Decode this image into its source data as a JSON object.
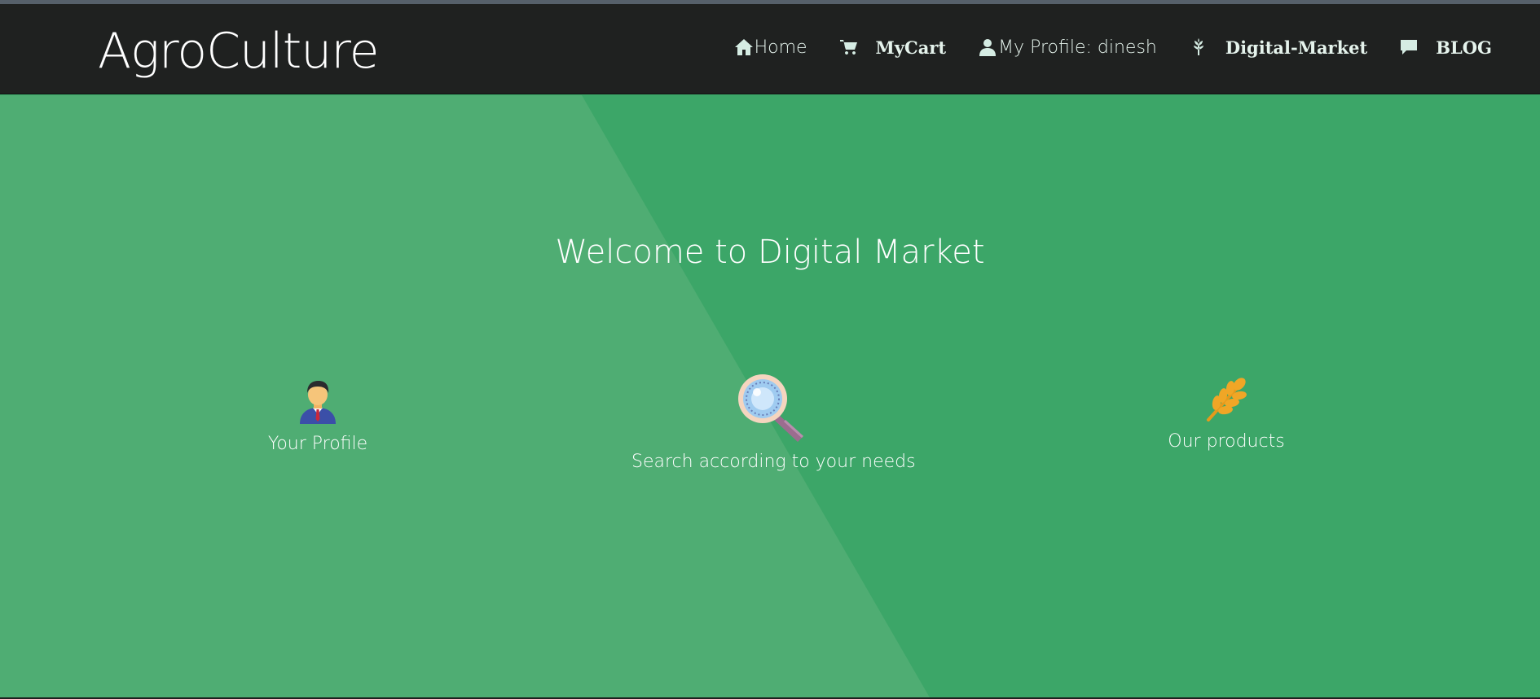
{
  "navbar": {
    "brand": "AgroCulture",
    "items": [
      {
        "label": "Home",
        "icon": "home-icon"
      },
      {
        "label": "MyCart",
        "icon": "cart-icon"
      },
      {
        "label": "My Profile: dinesh",
        "icon": "user-icon"
      },
      {
        "label": "Digital-Market",
        "icon": "grain-icon"
      },
      {
        "label": "BLOG",
        "icon": "comment-icon"
      }
    ]
  },
  "hero": {
    "title": "Welcome to Digital Market",
    "features": [
      {
        "label": "Your Profile",
        "icon": "businessman-icon"
      },
      {
        "label": "Search according to your needs",
        "icon": "magnifying-glass-icon"
      },
      {
        "label": "Our products",
        "icon": "wheat-icon"
      }
    ]
  },
  "colors": {
    "navbar_bg": "#1f2120",
    "hero_dark": "#3ca668",
    "hero_light": "#4fad73",
    "text": "#ffffff"
  }
}
